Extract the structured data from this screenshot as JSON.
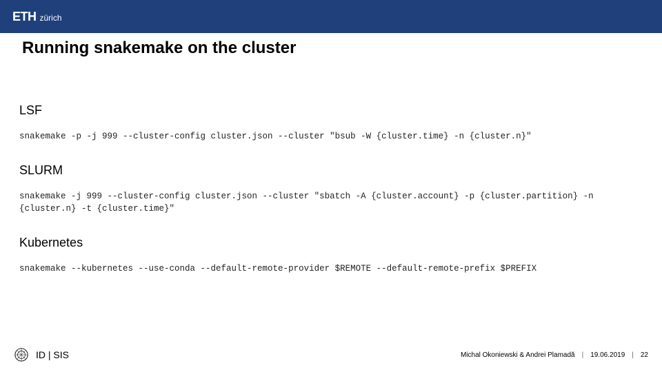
{
  "brand": {
    "main": "ETH",
    "sub": "zürich"
  },
  "title": "Running snakemake on the cluster",
  "sections": {
    "lsf": {
      "heading": "LSF",
      "command": "snakemake -p -j 999 --cluster-config cluster.json --cluster \"bsub -W {cluster.time} -n {cluster.n}\""
    },
    "slurm": {
      "heading": "SLURM",
      "command": "snakemake -j 999 --cluster-config cluster.json --cluster \"sbatch -A {cluster.account} -p {cluster.partition} -n {cluster.n} -t {cluster.time}\""
    },
    "kubernetes": {
      "heading": "Kubernetes",
      "command": "snakemake --kubernetes --use-conda --default-remote-provider $REMOTE --default-remote-prefix $PREFIX"
    }
  },
  "footer": {
    "dept": "ID | SIS",
    "authors": "Michal Okoniewski & Andrei Plamadă",
    "date": "19.06.2019",
    "page": "22"
  }
}
